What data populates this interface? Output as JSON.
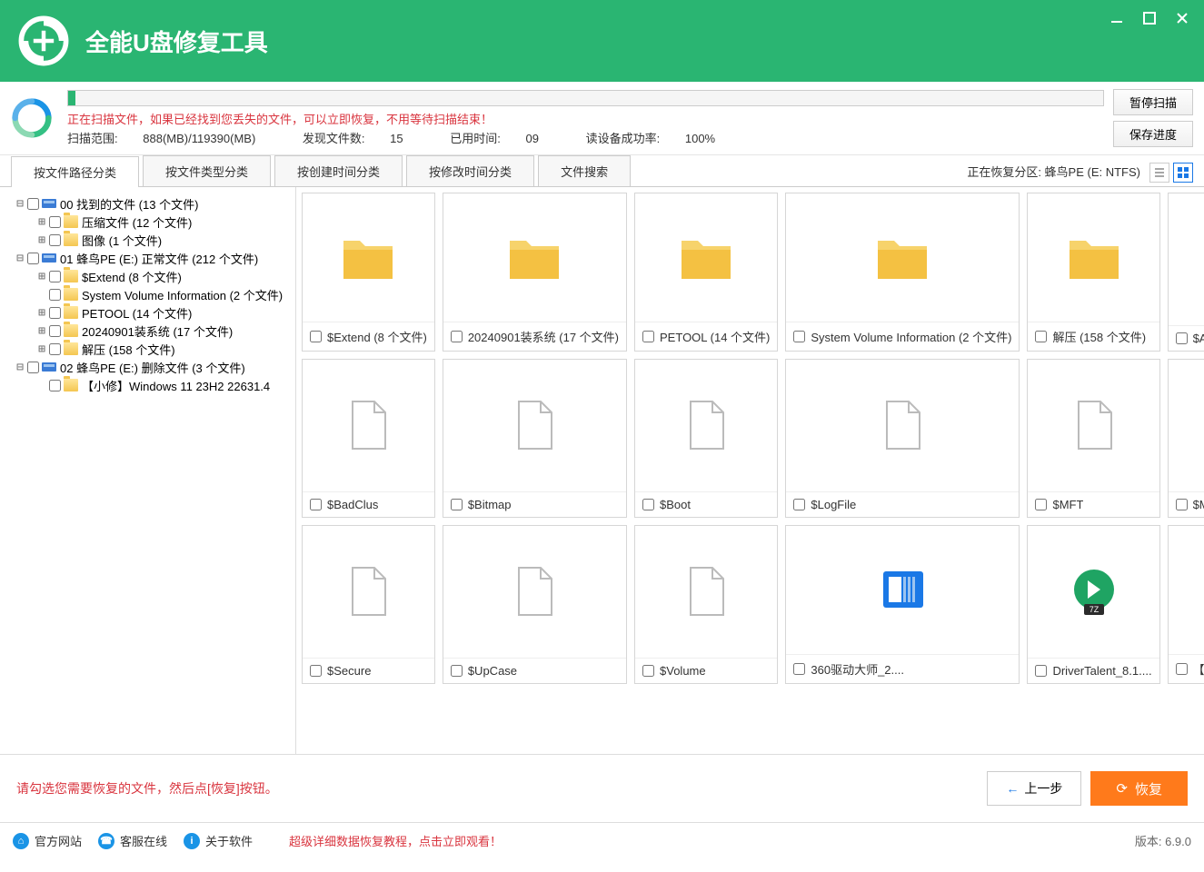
{
  "app_title": "全能U盘修复工具",
  "progress_percent": 0.74,
  "notice_red": "正在扫描文件，如果已经找到您丢失的文件，可以立即恢复，不用等待扫描结束！",
  "stats": {
    "scan_range_label": "扫描范围:",
    "scan_range_value": "888(MB)/119390(MB)",
    "found_label": "发现文件数:",
    "found_value": "15",
    "time_label": "已用时间:",
    "time_value": "09",
    "success_label": "读设备成功率:",
    "success_value": "100%"
  },
  "side_buttons": {
    "pause_scan": "暂停扫描",
    "save_progress": "保存进度"
  },
  "tabs": {
    "by_path": "按文件路径分类",
    "by_type": "按文件类型分类",
    "by_created": "按创建时间分类",
    "by_modified": "按修改时间分类",
    "file_search": "文件搜索"
  },
  "partition_text": "正在恢复分区: 蜂鸟PE (E: NTFS)",
  "tree": {
    "n1": "00 找到的文件  (13 个文件)",
    "n1_1": "压缩文件    (12 个文件)",
    "n1_2": "图像    (1 个文件)",
    "n2": "01 蜂鸟PE (E:) 正常文件 (212 个文件)",
    "n2_1": "$Extend    (8 个文件)",
    "n2_2": "System Volume Information    (2 个文件)",
    "n2_3": "PETOOL    (14 个文件)",
    "n2_4": "20240901装系统    (17 个文件)",
    "n2_5": "解压    (158 个文件)",
    "n3": "02 蜂鸟PE (E:) 删除文件 (3 个文件)",
    "n3_1": "【小修】Windows 11 23H2 22631.4"
  },
  "grid": {
    "i0": "$Extend  (8 个文件)",
    "i1": "20240901装系统  (17 个文件)",
    "i2": "PETOOL  (14 个文件)",
    "i3": "System Volume Information  (2 个文件)",
    "i4": "解压  (158 个文件)",
    "i5": "$AttrDef",
    "i6": "$BadClus",
    "i7": "$Bitmap",
    "i8": "$Boot",
    "i9": "$LogFile",
    "i10": "$MFT",
    "i11": "$MFTMirr",
    "i12": "$Secure",
    "i13": "$UpCase",
    "i14": "$Volume",
    "i15": "360驱动大师_2....",
    "i16": "DriverTalent_8.1....",
    "i17": "【MS-ZZY】Windows..."
  },
  "footer": {
    "hint": "请勾选您需要恢复的文件，然后点[恢复]按钮。",
    "prev": "上一步",
    "recover": "恢复",
    "link1": "官方网站",
    "link2": "客服在线",
    "link3": "关于软件",
    "promo": "超级详细数据恢复教程，点击立即观看！",
    "version": "版本: 6.9.0"
  }
}
